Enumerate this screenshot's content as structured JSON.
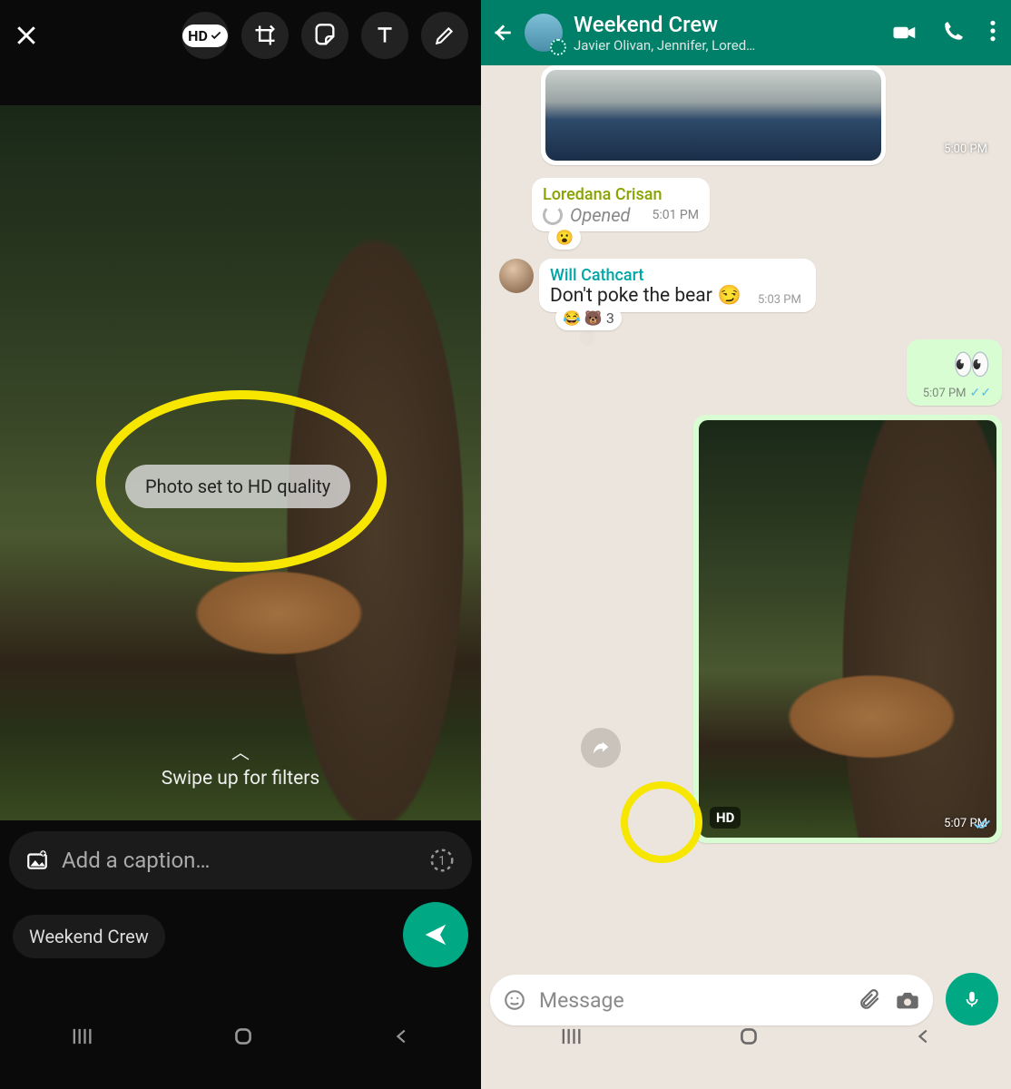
{
  "editor": {
    "tools": {
      "hd_label": "HD"
    },
    "toast": "Photo set to HD quality",
    "swipe_hint": "Swipe up for filters",
    "caption_placeholder": "Add a caption…",
    "recipient_chip": "Weekend Crew"
  },
  "chat": {
    "header": {
      "title": "Weekend Crew",
      "subtitle": "Javier Olivan, Jennifer, Lored…"
    },
    "messages": {
      "img1_time": "5:00 PM",
      "m1_sender": "Loredana Crisan",
      "m1_status": "Opened",
      "m1_time": "5:01 PM",
      "m1_react": "😮",
      "m2_sender": "Will Cathcart",
      "m2_text": "Don't poke the bear",
      "m2_emoji": "😏",
      "m2_time": "5:03 PM",
      "m2_react": "😂 🐻",
      "m2_react_count": "3",
      "m3_emoji": "👀",
      "m3_time": "5:07 PM",
      "m4_hd": "HD",
      "m4_time": "5:07 PM"
    },
    "input_placeholder": "Message"
  }
}
